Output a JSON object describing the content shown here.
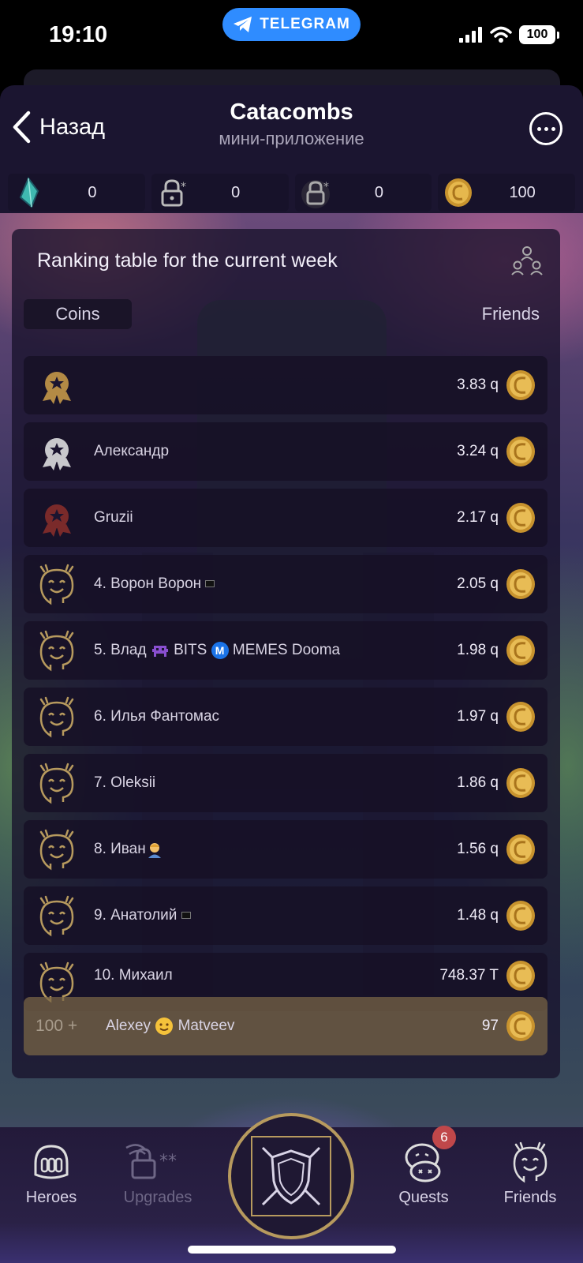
{
  "status_bar": {
    "time": "19:10",
    "telegram_label": "TELEGRAM",
    "battery": "100"
  },
  "header": {
    "back_label": "Назад",
    "title": "Catacombs",
    "subtitle": "мини-приложение"
  },
  "resources": [
    {
      "icon": "crystal-icon",
      "value": "0"
    },
    {
      "icon": "locked-resource-icon",
      "value": "0"
    },
    {
      "icon": "locked-resource-icon",
      "value": "0"
    },
    {
      "icon": "coin-icon",
      "value": "100"
    }
  ],
  "ranking": {
    "title": "Ranking table for the current week",
    "tab_coins": "Coins",
    "tab_friends": "Friends",
    "rows": [
      {
        "name": "",
        "score": "3.83 q",
        "medal": "gold"
      },
      {
        "name": "Александр",
        "score": "3.24 q",
        "medal": "silver"
      },
      {
        "name": "Gruzii",
        "score": "2.17 q",
        "medal": "bronze"
      },
      {
        "name": "4. Ворон Ворон",
        "score": "2.05 q"
      },
      {
        "name_parts": [
          "5. Влад",
          "BITS",
          "MEMES Dooma"
        ],
        "score": "1.98 q"
      },
      {
        "name": "6. Илья Фантомас",
        "score": "1.97 q"
      },
      {
        "name": "7. Oleksii",
        "score": "1.86 q"
      },
      {
        "name": "8. Иван",
        "score": "1.56 q"
      },
      {
        "name": "9. Анатолий",
        "score": "1.48 q"
      },
      {
        "name": "10. Михаил",
        "score": "748.37 T"
      }
    ],
    "me": {
      "rank": "100 +",
      "first": "Alexey",
      "last": "Matveev",
      "score": "97"
    }
  },
  "bottom_nav": {
    "heroes": "Heroes",
    "upgrades": "Upgrades",
    "quests": "Quests",
    "quests_badge": "6",
    "friends": "Friends"
  },
  "colors": {
    "accent_gold": "#b79a5e",
    "panel_bg": "#18122c",
    "telegram_blue": "#2f8cff",
    "badge_red": "#c0474a"
  }
}
